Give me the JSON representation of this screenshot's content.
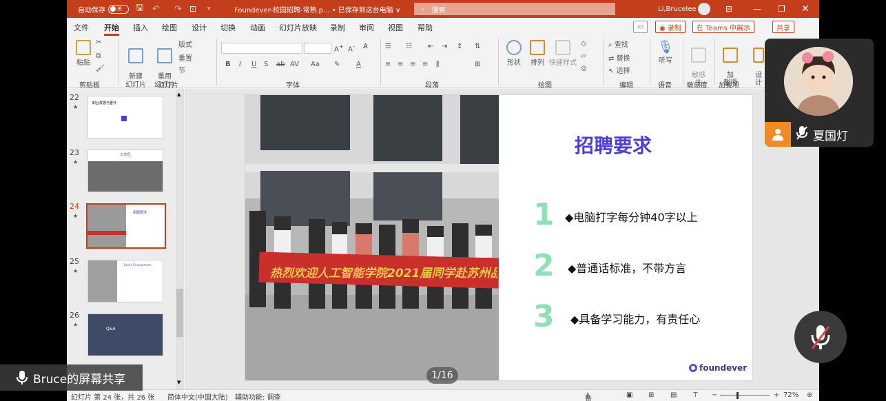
{
  "titlebar": {
    "autosave_label": "自动保存",
    "autosave_state": "关",
    "doc_title": "Foundever-校园招聘-常熟.p... • 已保存到这台电脑 ∨",
    "search_placeholder": "搜索",
    "user_name": "Li,Brucelee"
  },
  "ribbon_tabs": [
    "文件",
    "开始",
    "插入",
    "绘图",
    "设计",
    "切换",
    "动画",
    "幻灯片放映",
    "录制",
    "审阅",
    "视图",
    "帮助"
  ],
  "tab_buttons": {
    "record": "◉ 录制",
    "teams": "在 Teams 中展示",
    "share": "共享"
  },
  "ribbon": {
    "paste": "粘贴",
    "new_slide": "新建\n幻灯片",
    "reuse_slide": "重用\n幻灯片",
    "layout": "版式",
    "reset": "重置",
    "section": "节",
    "shapes": "形状",
    "arrange": "排列",
    "quick_styles": "快速样式",
    "find": "查找",
    "replace": "替换",
    "select": "选择",
    "dictate": "听写",
    "sensitivity": "敏感\n性",
    "addins": "加\n载项",
    "designer": "设\n计",
    "groups": [
      "剪贴板",
      "幻灯片",
      "字体",
      "段落",
      "绘图",
      "编辑",
      "语音",
      "敏感度",
      "加载项"
    ]
  },
  "thumbnails": [
    {
      "num": "22",
      "star": "★",
      "title": "职业发展与晋升"
    },
    {
      "num": "23",
      "star": "★",
      "title": "工作区"
    },
    {
      "num": "24",
      "star": "★",
      "title": "招聘要求"
    },
    {
      "num": "25",
      "star": "★",
      "title": "Green Environment"
    },
    {
      "num": "26",
      "star": "★",
      "title": "Q&A"
    }
  ],
  "slide": {
    "title": "招聘要求",
    "banner": "热烈欢迎人工智能学院2021届同学赴苏州品",
    "requirements": [
      {
        "num": "1",
        "text": "◆电脑打字每分钟40字以上"
      },
      {
        "num": "2",
        "text": "◆普通话标准，不带方言"
      },
      {
        "num": "3",
        "text": "◆具备学习能力，有责任心"
      }
    ],
    "brand": "foundever"
  },
  "statusbar": {
    "slide_count": "幻灯片 第 24 张，共 26 张",
    "language": "简体中文(中国大陆)",
    "accessibility": "辅助功能: 调查",
    "notes": "备注",
    "zoom": "72%"
  },
  "overlay": {
    "pager": "1/16",
    "share_label": "Bruce的屏幕共享",
    "participant_name": "夏国灯"
  },
  "colors": {
    "accent": "#c43e1c",
    "title_blue": "#4a3fd8",
    "number_green": "#8fe0b5",
    "banner_red": "#c9302c"
  }
}
